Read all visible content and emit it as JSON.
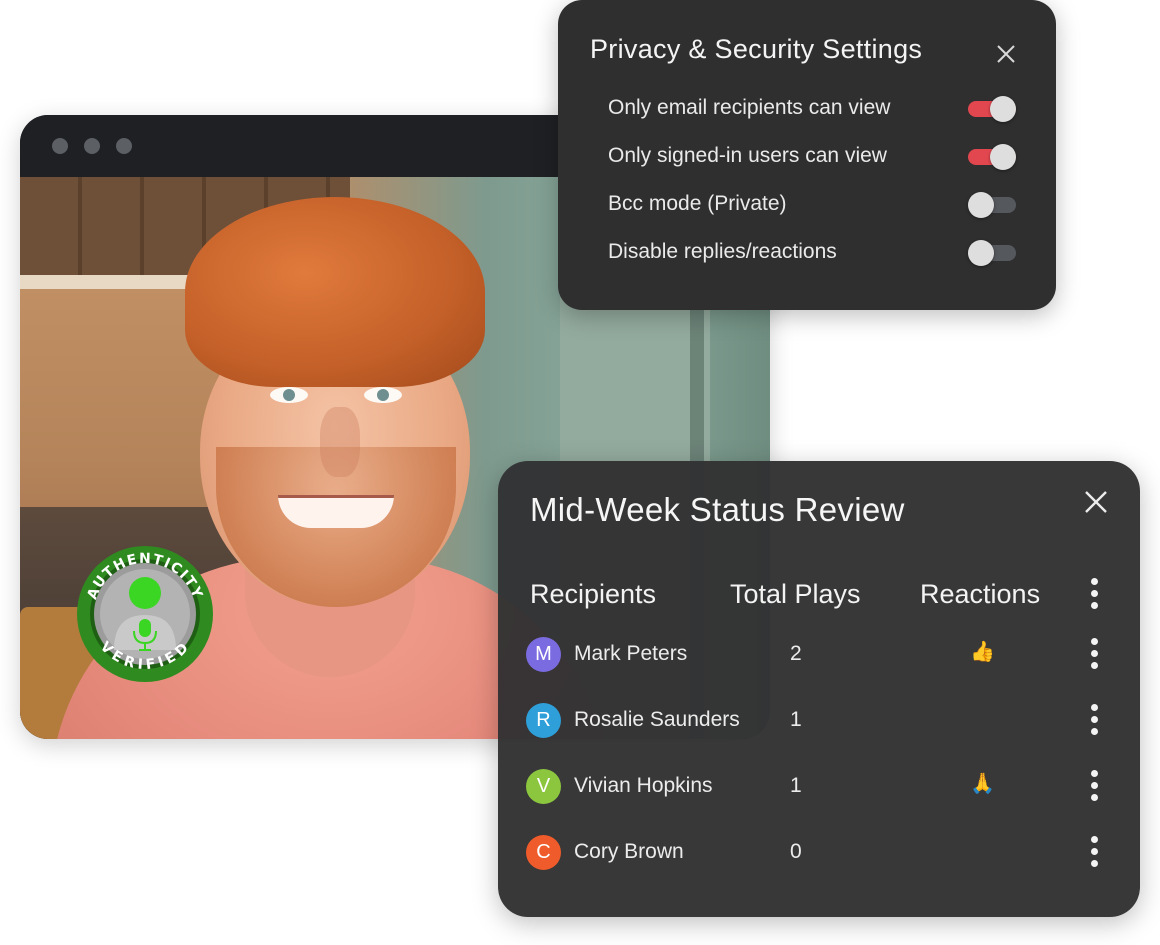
{
  "privacy": {
    "title": "Privacy & Security Settings",
    "settings": [
      {
        "label": "Only email recipients can view",
        "enabled": true
      },
      {
        "label": "Only signed-in users can view",
        "enabled": true
      },
      {
        "label": "Bcc mode (Private)",
        "enabled": false
      },
      {
        "label": "Disable replies/reactions",
        "enabled": false
      }
    ]
  },
  "badge": {
    "top_text": "AUTHENTICITY",
    "bottom_text": "VERIFIED"
  },
  "review": {
    "title": "Mid-Week Status Review",
    "columns": {
      "recipients": "Recipients",
      "plays": "Total Plays",
      "reactions": "Reactions"
    },
    "rows": [
      {
        "initial": "M",
        "name": "Mark Peters",
        "plays": "2",
        "reaction": "👍",
        "avatar_color": "#7b6be0"
      },
      {
        "initial": "R",
        "name": "Rosalie Saunders",
        "plays": "1",
        "reaction": "",
        "avatar_color": "#2e9fd8"
      },
      {
        "initial": "V",
        "name": "Vivian Hopkins",
        "plays": "1",
        "reaction": "🙏",
        "avatar_color": "#8cc63f"
      },
      {
        "initial": "C",
        "name": "Cory Brown",
        "plays": "0",
        "reaction": "",
        "avatar_color": "#ef5b2a"
      }
    ]
  },
  "colors": {
    "toggle_on": "#e2474f",
    "toggle_off": "#55585d",
    "badge_green": "#2f8a1f",
    "mic_green": "#3bd623"
  },
  "icons": {
    "close": "close-icon",
    "more": "more-vertical-icon",
    "mic": "microphone-icon"
  }
}
